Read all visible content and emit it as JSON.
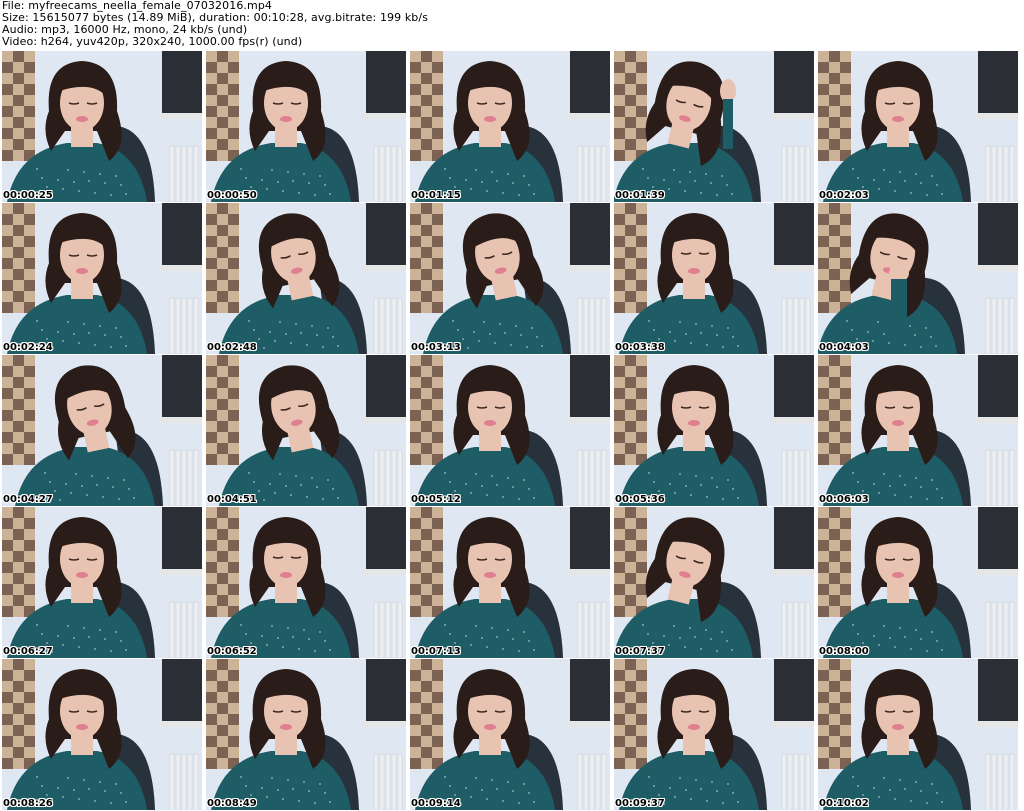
{
  "header": {
    "file_line": "File: myfreecams_neella_female_07032016.mp4",
    "size_line": "Size: 15615077 bytes (14.89 MiB), duration: 00:10:28, avg.bitrate: 199 kb/s",
    "audio_line": "Audio: mp3, 16000 Hz, mono, 24 kb/s (und)",
    "video_line": "Video: h264, yuv420p, 320x240, 1000.00 fps(r) (und)"
  },
  "colors": {
    "wall": "#dfe8f2",
    "skin": "#e9c3b1",
    "hair": "#2a1c18",
    "top": "#1e5c66",
    "lips": "#e07f8f",
    "chair": "#27323c",
    "screen": "#2b2f35",
    "tile_light": "#c9a886",
    "tile_dark": "#6b4a36"
  },
  "thumbnails": [
    {
      "timestamp": "00:00:25",
      "tilt": "center",
      "head": "down"
    },
    {
      "timestamp": "00:00:50",
      "tilt": "center",
      "head": "down"
    },
    {
      "timestamp": "00:01:15",
      "tilt": "center",
      "head": "down"
    },
    {
      "timestamp": "00:01:39",
      "tilt": "right",
      "head": "hand-in-hair"
    },
    {
      "timestamp": "00:02:03",
      "tilt": "center",
      "head": "down"
    },
    {
      "timestamp": "00:02:24",
      "tilt": "center",
      "head": "down"
    },
    {
      "timestamp": "00:02:48",
      "tilt": "left",
      "head": "tilted"
    },
    {
      "timestamp": "00:03:13",
      "tilt": "left",
      "head": "tilted"
    },
    {
      "timestamp": "00:03:38",
      "tilt": "center",
      "head": "forward"
    },
    {
      "timestamp": "00:04:03",
      "tilt": "right",
      "head": "hand-on-face"
    },
    {
      "timestamp": "00:04:27",
      "tilt": "left",
      "head": "down"
    },
    {
      "timestamp": "00:04:51",
      "tilt": "left",
      "head": "tilted"
    },
    {
      "timestamp": "00:05:12",
      "tilt": "center",
      "head": "down"
    },
    {
      "timestamp": "00:05:36",
      "tilt": "center",
      "head": "down"
    },
    {
      "timestamp": "00:06:03",
      "tilt": "center",
      "head": "down"
    },
    {
      "timestamp": "00:06:27",
      "tilt": "center",
      "head": "down"
    },
    {
      "timestamp": "00:06:52",
      "tilt": "center",
      "head": "forward"
    },
    {
      "timestamp": "00:07:13",
      "tilt": "center",
      "head": "down"
    },
    {
      "timestamp": "00:07:37",
      "tilt": "right",
      "head": "tilted"
    },
    {
      "timestamp": "00:08:00",
      "tilt": "center",
      "head": "down"
    },
    {
      "timestamp": "00:08:26",
      "tilt": "center",
      "head": "down"
    },
    {
      "timestamp": "00:08:49",
      "tilt": "center",
      "head": "down"
    },
    {
      "timestamp": "00:09:14",
      "tilt": "center",
      "head": "down"
    },
    {
      "timestamp": "00:09:37",
      "tilt": "center",
      "head": "down"
    },
    {
      "timestamp": "00:10:02",
      "tilt": "center",
      "head": "down"
    }
  ]
}
